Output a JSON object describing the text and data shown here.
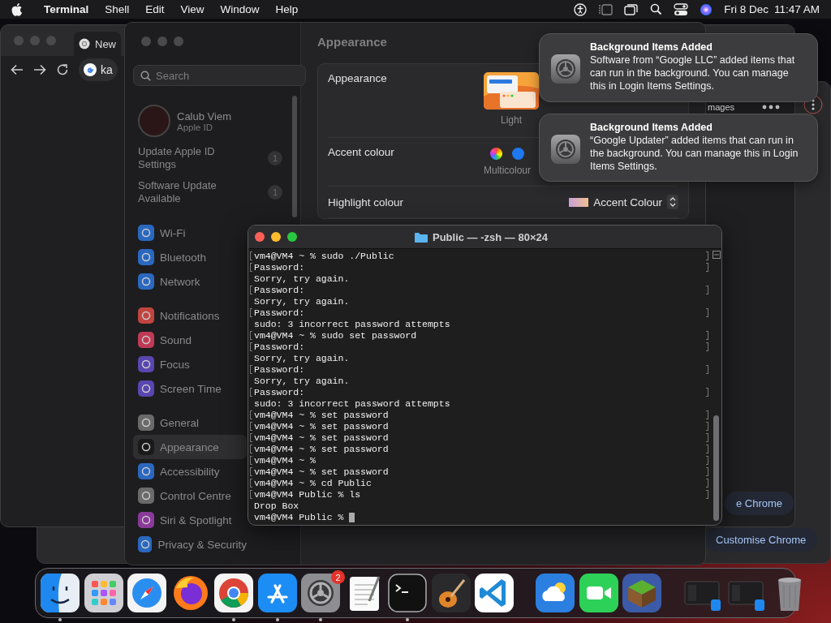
{
  "menu_bar": {
    "app_name": "Terminal",
    "menus": [
      "Shell",
      "Edit",
      "View",
      "Window",
      "Help"
    ],
    "date": "Fri 8 Dec",
    "time": "11:47 AM"
  },
  "browser_back": {
    "partial_text": "mages",
    "button": "Customise Chrome"
  },
  "browser_front": {
    "tab_title": "New",
    "address": "ka",
    "button": "e Chrome"
  },
  "settings": {
    "search": {
      "placeholder": "Search"
    },
    "account": {
      "name": "Calub Viem",
      "subtitle": "Apple ID"
    },
    "notices": [
      {
        "label": "Update Apple ID Settings",
        "badge": "1"
      },
      {
        "label": "Software Update Available",
        "badge": "1"
      }
    ],
    "sidebar_groups": [
      {
        "items": [
          {
            "label": "Wi-Fi",
            "color": "#2a68c0",
            "selected": false
          },
          {
            "label": "Bluetooth",
            "color": "#2a68c0",
            "selected": false
          },
          {
            "label": "Network",
            "color": "#2a68c0",
            "selected": false
          }
        ]
      },
      {
        "items": [
          {
            "label": "Notifications",
            "color": "#c0453f",
            "selected": false
          },
          {
            "label": "Sound",
            "color": "#c03a55",
            "selected": false
          },
          {
            "label": "Focus",
            "color": "#5a46b0",
            "selected": false
          },
          {
            "label": "Screen Time",
            "color": "#5a46b0",
            "selected": false
          }
        ]
      },
      {
        "items": [
          {
            "label": "General",
            "color": "#6a6a6a",
            "selected": false
          },
          {
            "label": "Appearance",
            "color": "#1a1a1a",
            "selected": true
          },
          {
            "label": "Accessibility",
            "color": "#2a68c0",
            "selected": false
          },
          {
            "label": "Control Centre",
            "color": "#6a6a6a",
            "selected": false
          },
          {
            "label": "Siri & Spotlight",
            "color": "#8a3a9a",
            "selected": false
          },
          {
            "label": "Privacy & Security",
            "color": "#2a68c0",
            "selected": false
          }
        ]
      }
    ],
    "title": "Appearance",
    "rows": [
      {
        "kind": "appearance",
        "label": "Appearance",
        "option_label": "Light"
      },
      {
        "kind": "accent",
        "label": "Accent colour",
        "option_label": "Multicolour"
      },
      {
        "kind": "popup",
        "label": "Highlight colour",
        "value": "Accent Colour"
      }
    ]
  },
  "notifications": [
    {
      "title": "Background Items Added",
      "body": "Software from “Google LLC” added items that can run in the background. You can manage this in Login Items Settings."
    },
    {
      "title": "Background Items Added",
      "body": "“Google Updater” added items that can run in the background. You can manage this in Login Items Settings."
    }
  ],
  "terminal": {
    "title": "Public — -zsh — 80×24",
    "lines": [
      {
        "text": "vm4@VM4 ~ % sudo ./Public",
        "marked": true
      },
      {
        "text": "Password:",
        "marked": true
      },
      {
        "text": "Sorry, try again.",
        "marked": false
      },
      {
        "text": "Password:",
        "marked": true
      },
      {
        "text": "Sorry, try again.",
        "marked": false
      },
      {
        "text": "Password:",
        "marked": true
      },
      {
        "text": "sudo: 3 incorrect password attempts",
        "marked": false
      },
      {
        "text": "vm4@VM4 ~ % sudo set password",
        "marked": true
      },
      {
        "text": "Password:",
        "marked": true
      },
      {
        "text": "Sorry, try again.",
        "marked": false
      },
      {
        "text": "Password:",
        "marked": true
      },
      {
        "text": "Sorry, try again.",
        "marked": false
      },
      {
        "text": "Password:",
        "marked": true
      },
      {
        "text": "sudo: 3 incorrect password attempts",
        "marked": false
      },
      {
        "text": "vm4@VM4 ~ % set password",
        "marked": true
      },
      {
        "text": "vm4@VM4 ~ % set password",
        "marked": true
      },
      {
        "text": "vm4@VM4 ~ % set password",
        "marked": true
      },
      {
        "text": "vm4@VM4 ~ % set password",
        "marked": true
      },
      {
        "text": "vm4@VM4 ~ %",
        "marked": true
      },
      {
        "text": "vm4@VM4 ~ % set password",
        "marked": true
      },
      {
        "text": "vm4@VM4 ~ % cd Public",
        "marked": true
      },
      {
        "text": "vm4@VM4 Public % ls",
        "marked": true
      },
      {
        "text": "Drop Box",
        "marked": false
      },
      {
        "text": "vm4@VM4 Public %",
        "marked": false
      }
    ]
  },
  "dock": {
    "sections": [
      [
        {
          "kind": "finder",
          "running": true
        },
        {
          "kind": "launchpad",
          "running": false
        },
        {
          "kind": "safari",
          "running": false
        },
        {
          "kind": "firefox",
          "running": false
        },
        {
          "kind": "chrome",
          "running": true
        },
        {
          "kind": "appstore",
          "running": true
        },
        {
          "kind": "settings",
          "running": true,
          "badge": "2"
        },
        {
          "kind": "textedit",
          "running": false
        },
        {
          "kind": "terminal",
          "running": true
        },
        {
          "kind": "garageband",
          "running": false
        },
        {
          "kind": "vscode",
          "running": false
        }
      ],
      [
        {
          "kind": "weather",
          "running": false
        },
        {
          "kind": "facetime",
          "running": false
        },
        {
          "kind": "minecraft",
          "running": false
        }
      ],
      [
        {
          "kind": "minimized",
          "running": false
        },
        {
          "kind": "minimized",
          "running": false
        },
        {
          "kind": "trash",
          "running": false
        }
      ]
    ]
  }
}
